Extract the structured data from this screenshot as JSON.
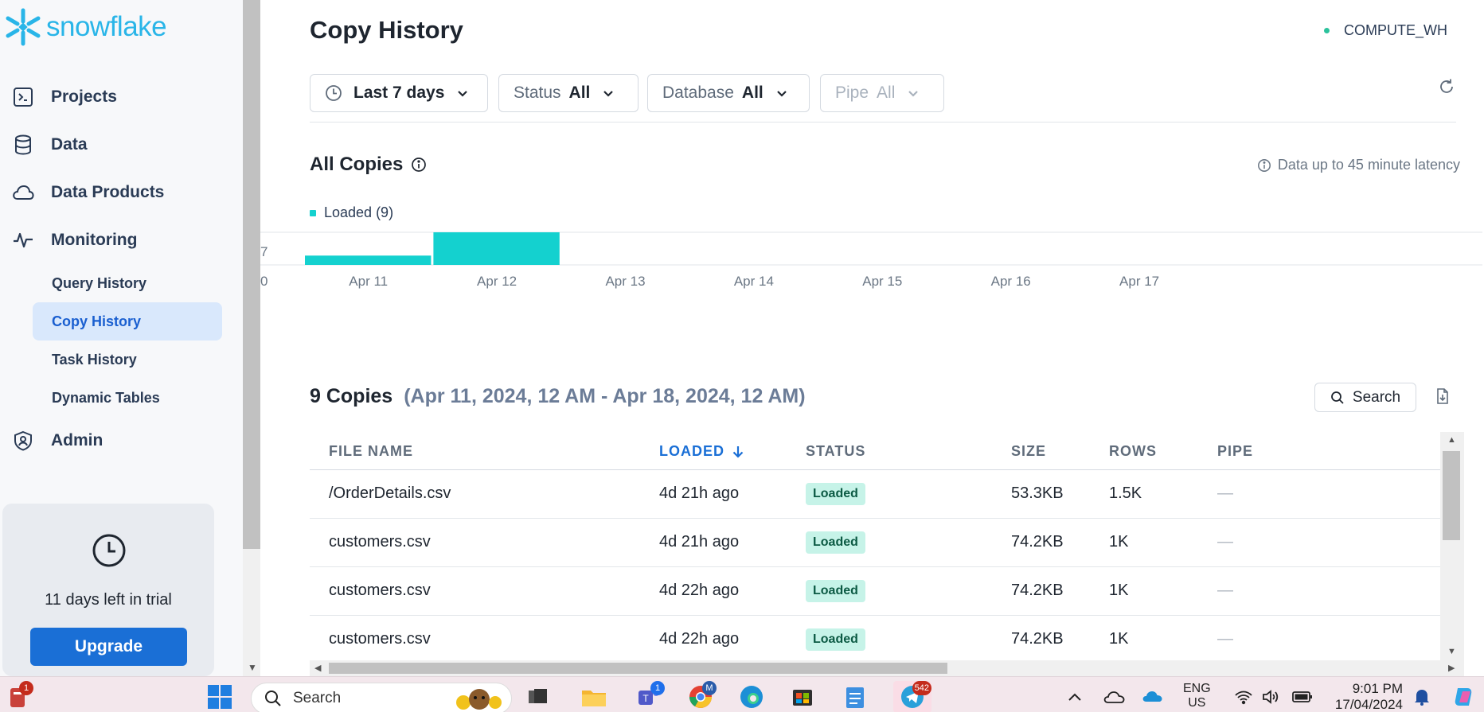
{
  "sidebar": {
    "logo_text": "snowflake",
    "nav": [
      {
        "label": "Projects",
        "icon": "terminal-icon"
      },
      {
        "label": "Data",
        "icon": "database-icon"
      },
      {
        "label": "Data Products",
        "icon": "cloud-icon"
      },
      {
        "label": "Monitoring",
        "icon": "activity-icon"
      }
    ],
    "sub_items": [
      "Query History",
      "Copy History",
      "Task History",
      "Dynamic Tables"
    ],
    "active_sub": "Copy History",
    "admin_label": "Admin",
    "trial_text": "11 days left in trial",
    "upgrade_label": "Upgrade"
  },
  "header": {
    "title": "Copy History",
    "warehouse": "COMPUTE_WH",
    "warehouse_status_color": "#2bc29c"
  },
  "filters": {
    "date": {
      "value": "Last 7 days"
    },
    "status": {
      "label": "Status",
      "value": "All"
    },
    "database": {
      "label": "Database",
      "value": "All"
    },
    "pipe": {
      "label": "Pipe",
      "value": "All"
    }
  },
  "section": {
    "title": "All Copies",
    "latency_note": "Data up to 45 minute latency"
  },
  "chart_data": {
    "type": "bar",
    "categories": [
      "Apr 11",
      "Apr 12",
      "Apr 13",
      "Apr 14",
      "Apr 15",
      "Apr 16",
      "Apr 17"
    ],
    "series": [
      {
        "name": "Loaded (9)",
        "values": [
          2,
          7,
          0,
          0,
          0,
          0,
          0
        ],
        "color": "#14d1cf"
      }
    ],
    "y_ticks": [
      "0",
      "7"
    ],
    "ylim": [
      0,
      7
    ],
    "legend": "top-left"
  },
  "copies": {
    "count_label": "9 Copies",
    "range_label": "(Apr 11, 2024, 12 AM - Apr 18, 2024, 12 AM)",
    "search_label": "Search",
    "columns": [
      "FILE NAME",
      "LOADED",
      "STATUS",
      "SIZE",
      "ROWS",
      "PIPE"
    ],
    "sorted_column": "LOADED",
    "rows": [
      {
        "file": "/OrderDetails.csv",
        "loaded": "4d 21h ago",
        "status": "Loaded",
        "size": "53.3KB",
        "rows": "1.5K",
        "pipe": "—"
      },
      {
        "file": "customers.csv",
        "loaded": "4d 21h ago",
        "status": "Loaded",
        "size": "74.2KB",
        "rows": "1K",
        "pipe": "—"
      },
      {
        "file": "customers.csv",
        "loaded": "4d 22h ago",
        "status": "Loaded",
        "size": "74.2KB",
        "rows": "1K",
        "pipe": "—"
      },
      {
        "file": "customers.csv",
        "loaded": "4d 22h ago",
        "status": "Loaded",
        "size": "74.2KB",
        "rows": "1K",
        "pipe": "—"
      }
    ]
  },
  "taskbar": {
    "search_placeholder": "Search",
    "lang_top": "ENG",
    "lang_bottom": "US",
    "time": "9:01 PM",
    "date": "17/04/2024",
    "badges": {
      "left": "1",
      "teams": "1",
      "chrome": "M",
      "telegram": "542"
    }
  }
}
